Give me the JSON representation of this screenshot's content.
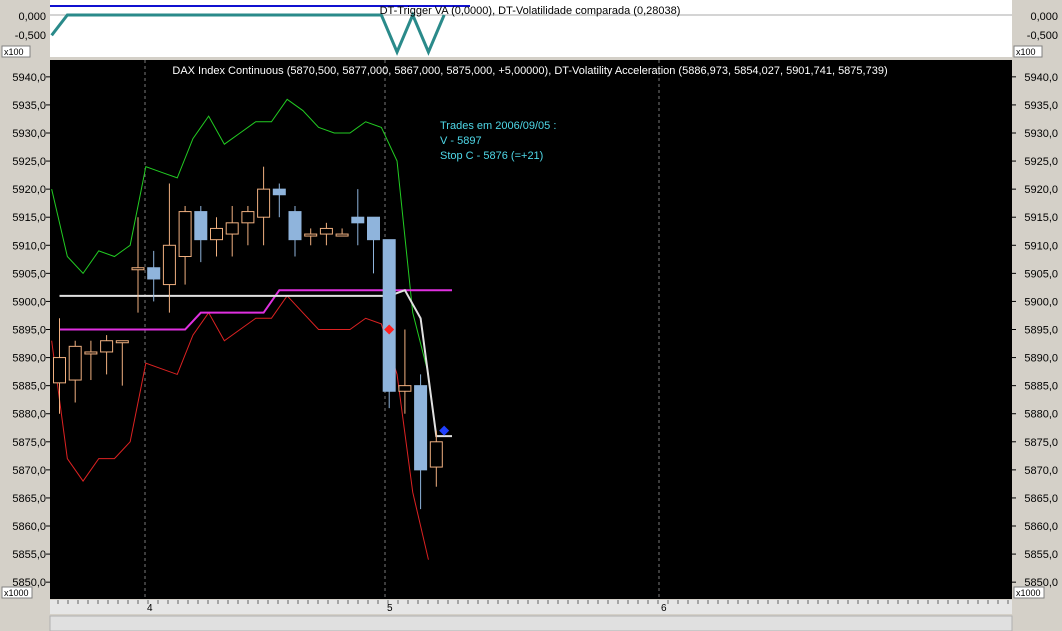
{
  "colors": {
    "background_chart": "#000000",
    "background_top": "#ffffff",
    "upper_band": "#22cc22",
    "lower_band": "#dd2222",
    "mid_line": "#e0e0e0",
    "magenta_line": "#e030e0",
    "bull_candle_edge": "#f0b080",
    "bear_candle_fill": "#8fb4dc",
    "annotation": "#4fd8e8",
    "trigger_line": "#2a8a8a",
    "trigger_zero": "#1010d0",
    "sell_marker": "#ff2020",
    "stop_marker": "#2040ff"
  },
  "top_panel": {
    "title": "DT-Trigger VA (0,0000), DT-Volatilidade comparada (0,28038)",
    "left_ticks": [
      "0,000",
      "-0,500"
    ],
    "right_ticks": [
      "0,000",
      "-0,500"
    ],
    "multiplier": "x100"
  },
  "main_panel": {
    "title": "DAX Index Continuous (5870,500, 5877,000, 5867,000, 5875,000, +5,00000), DT-Volatility Acceleration (5886,973, 5854,027, 5901,741, 5875,739)",
    "annotation": {
      "line1": "Trades em 2006/09/05 :",
      "line2": "V - 5897",
      "line3": "Stop C - 5876 (=+21)"
    },
    "multiplier": "x1000",
    "x_labels": [
      "4",
      "5",
      "6"
    ]
  },
  "chart_data": {
    "type": "candlestick",
    "ylim": [
      5847,
      5943
    ],
    "y_ticks": [
      "5850,0",
      "5855,0",
      "5860,0",
      "5865,0",
      "5870,0",
      "5875,0",
      "5880,0",
      "5885,0",
      "5890,0",
      "5895,0",
      "5900,0",
      "5905,0",
      "5910,0",
      "5915,0",
      "5920,0",
      "5925,0",
      "5930,0",
      "5935,0",
      "5940,0"
    ],
    "y_tick_values": [
      5850,
      5855,
      5860,
      5865,
      5870,
      5875,
      5880,
      5885,
      5890,
      5895,
      5900,
      5905,
      5910,
      5915,
      5920,
      5925,
      5930,
      5935,
      5940
    ],
    "candles": [
      {
        "o": 5885.5,
        "h": 5897,
        "l": 5880,
        "c": 5890
      },
      {
        "o": 5886,
        "h": 5893,
        "l": 5882,
        "c": 5892
      },
      {
        "o": 5891,
        "h": 5893,
        "l": 5886,
        "c": 5891
      },
      {
        "o": 5891,
        "h": 5894,
        "l": 5887,
        "c": 5893
      },
      {
        "o": 5893,
        "h": 5893,
        "l": 5885,
        "c": 5893
      },
      {
        "o": 5906,
        "h": 5915,
        "l": 5898,
        "c": 5906
      },
      {
        "o": 5906,
        "h": 5909,
        "l": 5900,
        "c": 5904
      },
      {
        "o": 5903,
        "h": 5921,
        "l": 5898,
        "c": 5910
      },
      {
        "o": 5908,
        "h": 5917,
        "l": 5903,
        "c": 5916
      },
      {
        "o": 5916,
        "h": 5917,
        "l": 5907,
        "c": 5911
      },
      {
        "o": 5911,
        "h": 5915,
        "l": 5908,
        "c": 5913
      },
      {
        "o": 5912,
        "h": 5917,
        "l": 5908,
        "c": 5914
      },
      {
        "o": 5914,
        "h": 5917,
        "l": 5910,
        "c": 5916
      },
      {
        "o": 5915,
        "h": 5924,
        "l": 5910,
        "c": 5920
      },
      {
        "o": 5920,
        "h": 5921,
        "l": 5915,
        "c": 5919
      },
      {
        "o": 5916,
        "h": 5917,
        "l": 5908,
        "c": 5911
      },
      {
        "o": 5912,
        "h": 5913,
        "l": 5910,
        "c": 5912
      },
      {
        "o": 5912,
        "h": 5914,
        "l": 5910,
        "c": 5913
      },
      {
        "o": 5912,
        "h": 5913,
        "l": 5912,
        "c": 5912
      },
      {
        "o": 5915,
        "h": 5920,
        "l": 5910,
        "c": 5914
      },
      {
        "o": 5915,
        "h": 5915,
        "l": 5905,
        "c": 5911
      },
      {
        "o": 5911,
        "h": 5911,
        "l": 5881,
        "c": 5884
      },
      {
        "o": 5884,
        "h": 5895,
        "l": 5880,
        "c": 5885
      },
      {
        "o": 5885,
        "h": 5887,
        "l": 5863,
        "c": 5870
      },
      {
        "o": 5870.5,
        "h": 5877,
        "l": 5867,
        "c": 5875
      }
    ],
    "upper_band": [
      5920,
      5908,
      5905,
      5909,
      5908,
      5910,
      5924,
      5923,
      5922,
      5929,
      5933,
      5928,
      5930,
      5932,
      5932,
      5936,
      5934,
      5931,
      5930,
      5930,
      5932,
      5931,
      5925,
      5898,
      5887
    ],
    "lower_band": [
      5893,
      5872,
      5868,
      5872,
      5872,
      5875,
      5889,
      5888,
      5887,
      5894,
      5898,
      5893,
      5895,
      5897,
      5897,
      5901,
      5898,
      5895,
      5895,
      5895,
      5897,
      5896,
      5887,
      5866,
      5854
    ],
    "mid_line": {
      "x0": 0,
      "x1": 21,
      "value": 5901,
      "tail": [
        {
          "i": 21,
          "v": 5901
        },
        {
          "i": 22,
          "v": 5902
        },
        {
          "i": 23,
          "v": 5897
        },
        {
          "i": 24,
          "v": 5876
        },
        {
          "i": 25,
          "v": 5876
        }
      ]
    },
    "magenta_line": [
      {
        "i": 0,
        "v": 5895
      },
      {
        "i": 8,
        "v": 5895
      },
      {
        "i": 9,
        "v": 5898
      },
      {
        "i": 13,
        "v": 5898
      },
      {
        "i": 14,
        "v": 5902
      },
      {
        "i": 25,
        "v": 5902
      }
    ],
    "sell_marker": {
      "index": 21,
      "value": 5895
    },
    "stop_marker": {
      "index": 24.5,
      "value": 5877
    },
    "trigger_line": [
      {
        "i": -0.5,
        "v": -0.55
      },
      {
        "i": 0.5,
        "v": 0
      },
      {
        "i": 20.5,
        "v": 0
      },
      {
        "i": 21.5,
        "v": -1
      },
      {
        "i": 22.5,
        "v": 0
      },
      {
        "i": 23.5,
        "v": -1
      },
      {
        "i": 24.5,
        "v": 0
      }
    ]
  }
}
